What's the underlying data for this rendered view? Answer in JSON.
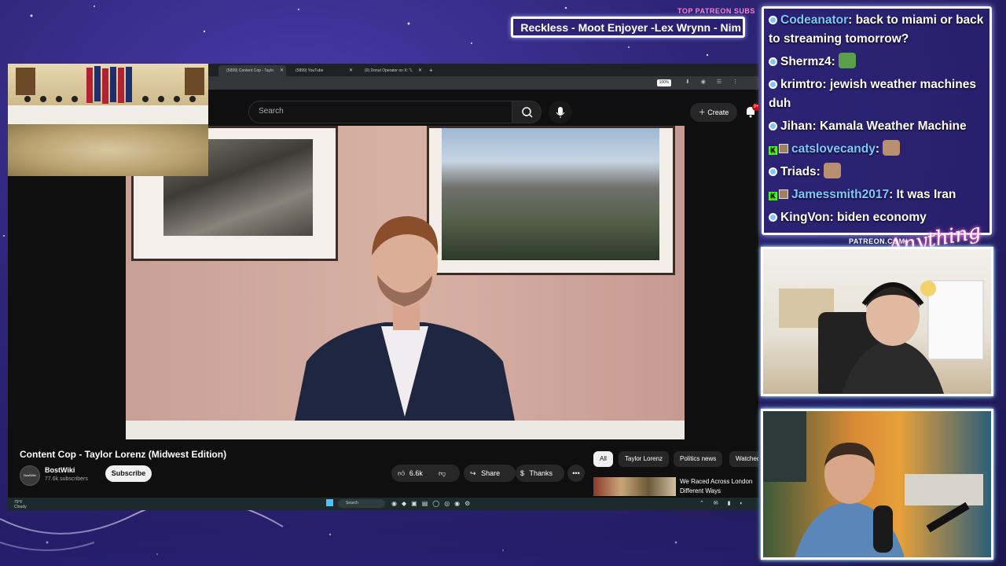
{
  "overlay": {
    "subs_label": "TOP PATREON SUBS",
    "subs_ticker": "Reckless - Moot Enjoyer -Lex Wrynn - Nim",
    "patreon_label": "PATREON.COM/",
    "logo_text": "Anything Else?"
  },
  "browser": {
    "tabs": [
      {
        "label": "(5899) Content Cop - Taylo",
        "active": true
      },
      {
        "label": "(5899) YouTube",
        "active": false
      },
      {
        "label": "(0) Donut Operator on X: \"L",
        "active": false
      }
    ],
    "new_tab": "+",
    "zoom": "100%"
  },
  "youtube": {
    "search_placeholder": "Search",
    "create_label": "Create",
    "notif_count": "9+",
    "video_title": "Content Cop - Taylor Lorenz (Midwest Edition)",
    "channel_name": "BostWiki",
    "channel_avatar_text": "BostWiki",
    "channel_subs": "77.6k subscribers",
    "subscribe_label": "Subscribe",
    "like_count": "6.6k",
    "share_label": "Share",
    "thanks_label": "Thanks",
    "chips": [
      "All",
      "Taylor Lorenz",
      "Politics news",
      "Watched"
    ],
    "rec_title": "We Raced Across London Different Ways"
  },
  "taskbar": {
    "weather_temp": "79°F",
    "weather_desc": "Cloudy",
    "search": "Search"
  },
  "chat": {
    "messages": [
      {
        "badge": "dot",
        "user": "Codeanator",
        "user_color": "#7ec8ff",
        "text": ": back to miami or back to streaming tomorrow?",
        "emote": ""
      },
      {
        "badge": "dot",
        "user": "Shermz4",
        "user_color": "#ffffff",
        "text": ": ",
        "emote": "frog"
      },
      {
        "badge": "dot",
        "user": "krimtro",
        "user_color": "#ffffff",
        "text": ": jewish weather machines duh",
        "emote": ""
      },
      {
        "badge": "dot",
        "user": "Jihan",
        "user_color": "#ffffff",
        "text": ": Kamala Weather Machine",
        "emote": ""
      },
      {
        "badge": "k",
        "user": "catslovecandy",
        "user_color": "#7ec8ff",
        "text": ": ",
        "emote": "face"
      },
      {
        "badge": "dot",
        "user": "Triads",
        "user_color": "#ffffff",
        "text": ": ",
        "emote": "face"
      },
      {
        "badge": "k",
        "user": "Jamessmith2017",
        "user_color": "#7ec8ff",
        "text": ": It was Iran",
        "emote": ""
      },
      {
        "badge": "dot",
        "user": "KingVon",
        "user_color": "#ffffff",
        "text": ": biden economy",
        "emote": ""
      }
    ]
  },
  "colors": {
    "accent_pink": "#ff7fd0",
    "accent_cyan": "#7af6ff",
    "username_blue": "#7ec8ff",
    "kick_green": "#53fc18"
  }
}
